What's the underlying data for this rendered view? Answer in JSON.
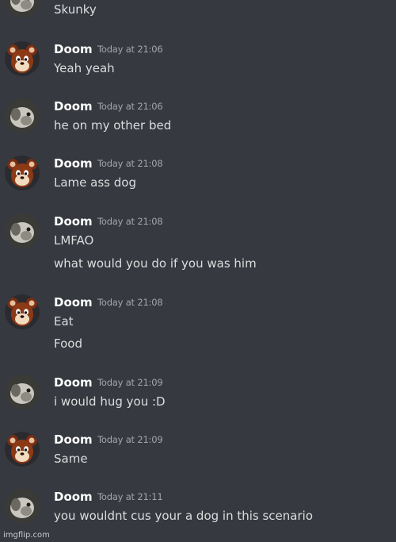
{
  "top_partial": {
    "text": "Skunky",
    "avatar": "dog-avatar"
  },
  "messages": [
    {
      "username": "Doom",
      "timestamp": "Today at 21:06",
      "avatar": "chipmunk-avatar",
      "lines": [
        "Yeah yeah"
      ]
    },
    {
      "username": "Doom",
      "timestamp": "Today at 21:06",
      "avatar": "dog-avatar",
      "lines": [
        "he on my other bed"
      ]
    },
    {
      "username": "Doom",
      "timestamp": "Today at 21:08",
      "avatar": "chipmunk-avatar",
      "lines": [
        "Lame ass dog"
      ]
    },
    {
      "username": "Doom",
      "timestamp": "Today at 21:08",
      "avatar": "dog-avatar",
      "lines": [
        "LMFAO",
        "what would you do if you was him"
      ]
    },
    {
      "username": "Doom",
      "timestamp": "Today at 21:08",
      "avatar": "chipmunk-avatar",
      "lines": [
        "Eat",
        "Food"
      ]
    },
    {
      "username": "Doom",
      "timestamp": "Today at 21:09",
      "avatar": "dog-avatar",
      "lines": [
        "i would hug you :D"
      ]
    },
    {
      "username": "Doom",
      "timestamp": "Today at 21:09",
      "avatar": "chipmunk-avatar",
      "lines": [
        "Same"
      ]
    },
    {
      "username": "Doom",
      "timestamp": "Today at 21:11",
      "avatar": "dog-avatar",
      "lines": [
        "you wouldnt cus your a dog in this scenario"
      ]
    }
  ],
  "watermark": "imgflip.com",
  "colors": {
    "background": "#36393f",
    "username": "#ffffff",
    "timestamp": "#a3a6aa",
    "message_text": "#dcddde"
  }
}
